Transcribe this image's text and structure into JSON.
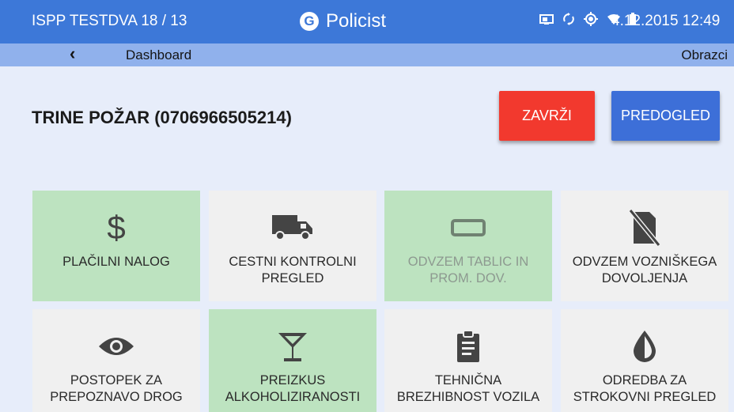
{
  "status_bar": {
    "device_label": "ISPP TESTDVA 18 / 13",
    "app_name": "Policist",
    "datetime": "4.12.2015 12:49",
    "icons": [
      "cast-icon",
      "sync-icon",
      "gps-icon",
      "wifi-icon",
      "battery-icon"
    ]
  },
  "nav": {
    "back_icon": "chevron-left-icon",
    "crumb": "Dashboard",
    "right_link": "Obrazci"
  },
  "person": {
    "name": "TRINE POŽAR (0706966505214)"
  },
  "actions": {
    "discard_label": "ZAVRŽI",
    "preview_label": "PREDOGLED",
    "discard_color": "#f2392e",
    "preview_color": "#3d6fd8"
  },
  "tiles": [
    {
      "label": "PLAČILNI NALOG",
      "icon": "dollar-icon",
      "state": "selected"
    },
    {
      "label": "CESTNI KONTROLNI PREGLED",
      "icon": "truck-icon",
      "state": "default"
    },
    {
      "label": "ODVZEM TABLIC IN PROM. DOV.",
      "icon": "license-plate-icon",
      "state": "disabled"
    },
    {
      "label": "ODVZEM VOZNIŠKEGA DOVOLJENJA",
      "icon": "no-license-icon",
      "state": "default"
    },
    {
      "label": "POSTOPEK ZA PREPOZNAVO DROG",
      "icon": "eye-icon",
      "state": "default"
    },
    {
      "label": "PREIZKUS ALKOHOLIZIRANOSTI",
      "icon": "cocktail-glass-icon",
      "state": "selected"
    },
    {
      "label": "TEHNIČNA BREZHIBNOST VOZILA",
      "icon": "clipboard-icon",
      "state": "default"
    },
    {
      "label": "ODREDBA ZA STROKOVNI PREGLED",
      "icon": "water-drop-icon",
      "state": "default"
    }
  ],
  "colors": {
    "header": "#3d78d8",
    "nav": "#90b1ec",
    "background": "#e7edfa",
    "tile_selected": "#bde3c0",
    "tile_default": "#f0f0f0"
  }
}
